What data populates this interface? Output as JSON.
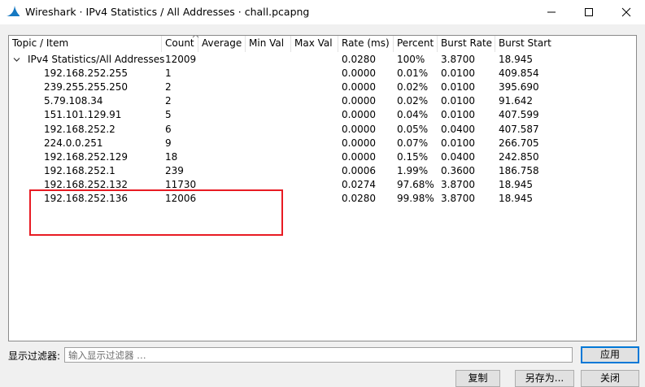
{
  "window": {
    "title": "Wireshark · IPv4 Statistics / All Addresses · chall.pcapng"
  },
  "columns": [
    "Topic / Item",
    "Count",
    "Average",
    "Min Val",
    "Max Val",
    "Rate (ms)",
    "Percent",
    "Burst Rate",
    "Burst Start"
  ],
  "rows": [
    {
      "topic": "IPv4 Statistics/All Addresses",
      "count": "12009",
      "rate": "0.0280",
      "percent": "100%",
      "burst_rate": "3.8700",
      "burst_start": "18.945",
      "root": true
    },
    {
      "topic": "192.168.252.255",
      "count": "1",
      "rate": "0.0000",
      "percent": "0.01%",
      "burst_rate": "0.0100",
      "burst_start": "409.854"
    },
    {
      "topic": "239.255.255.250",
      "count": "2",
      "rate": "0.0000",
      "percent": "0.02%",
      "burst_rate": "0.0100",
      "burst_start": "395.690"
    },
    {
      "topic": "5.79.108.34",
      "count": "2",
      "rate": "0.0000",
      "percent": "0.02%",
      "burst_rate": "0.0100",
      "burst_start": "91.642"
    },
    {
      "topic": "151.101.129.91",
      "count": "5",
      "rate": "0.0000",
      "percent": "0.04%",
      "burst_rate": "0.0100",
      "burst_start": "407.599"
    },
    {
      "topic": "192.168.252.2",
      "count": "6",
      "rate": "0.0000",
      "percent": "0.05%",
      "burst_rate": "0.0400",
      "burst_start": "407.587"
    },
    {
      "topic": "224.0.0.251",
      "count": "9",
      "rate": "0.0000",
      "percent": "0.07%",
      "burst_rate": "0.0100",
      "burst_start": "266.705"
    },
    {
      "topic": "192.168.252.129",
      "count": "18",
      "rate": "0.0000",
      "percent": "0.15%",
      "burst_rate": "0.0400",
      "burst_start": "242.850"
    },
    {
      "topic": "192.168.252.1",
      "count": "239",
      "rate": "0.0006",
      "percent": "1.99%",
      "burst_rate": "0.3600",
      "burst_start": "186.758"
    },
    {
      "topic": "192.168.252.132",
      "count": "11730",
      "rate": "0.0274",
      "percent": "97.68%",
      "burst_rate": "3.8700",
      "burst_start": "18.945"
    },
    {
      "topic": "192.168.252.136",
      "count": "12006",
      "rate": "0.0280",
      "percent": "99.98%",
      "burst_rate": "3.8700",
      "burst_start": "18.945"
    }
  ],
  "filter": {
    "label": "显示过滤器:",
    "placeholder": "输入显示过滤器 …",
    "value": ""
  },
  "buttons": {
    "apply": "应用",
    "copy": "复制",
    "save_as": "另存为...",
    "close": "关闭"
  },
  "icons": {
    "app": "wireshark-fin-icon",
    "minimize": "minimize-icon",
    "maximize": "maximize-icon",
    "close": "close-icon",
    "expander": "chevron-down-icon",
    "sort": "sort-caret-icon"
  },
  "colors": {
    "accent": "#1679c2",
    "highlight_annotation": "#e81b23"
  }
}
